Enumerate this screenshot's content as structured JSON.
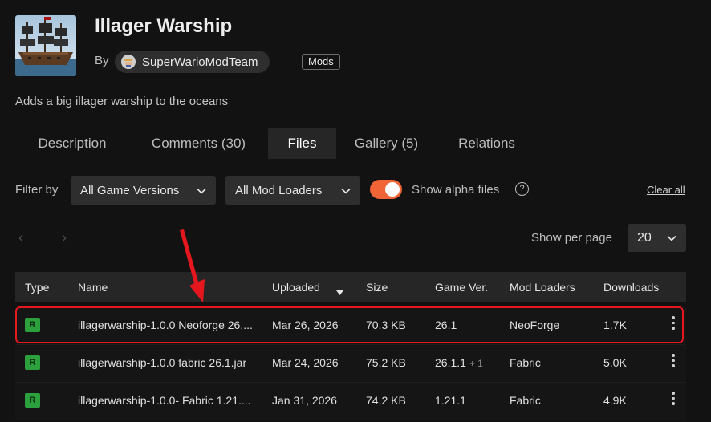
{
  "project": {
    "title": "Illager Warship",
    "by_label": "By",
    "author": "SuperWarioModTeam",
    "category_badge": "Mods",
    "summary": "Adds a big illager warship to the oceans"
  },
  "tabs": [
    {
      "label": "Description",
      "active": false
    },
    {
      "label": "Comments (30)",
      "active": false
    },
    {
      "label": "Files",
      "active": true
    },
    {
      "label": "Gallery (5)",
      "active": false
    },
    {
      "label": "Relations",
      "active": false
    }
  ],
  "filters": {
    "label": "Filter by",
    "game_versions": "All Game Versions",
    "mod_loaders": "All Mod Loaders",
    "show_alpha_label": "Show alpha files",
    "show_alpha_on": true,
    "help_glyph": "?",
    "clear_all": "Clear all"
  },
  "pagination": {
    "prev_glyph": "‹",
    "next_glyph": "›",
    "per_page_label": "Show per page",
    "per_page_value": "20"
  },
  "table": {
    "columns": {
      "type": "Type",
      "name": "Name",
      "uploaded": "Uploaded",
      "size": "Size",
      "game_ver": "Game Ver.",
      "mod_loaders": "Mod Loaders",
      "downloads": "Downloads"
    },
    "rows": [
      {
        "type": "R",
        "name": "illagerwarship-1.0.0 Neoforge 26....",
        "uploaded": "Mar 26, 2026",
        "size": "70.3 KB",
        "game_ver": "26.1",
        "game_ver_extra": "",
        "loader": "NeoForge",
        "downloads": "1.7K"
      },
      {
        "type": "R",
        "name": "illagerwarship-1.0.0 fabric 26.1.jar",
        "uploaded": "Mar 24, 2026",
        "size": "75.2 KB",
        "game_ver": "26.1.1",
        "game_ver_extra": "+ 1",
        "loader": "Fabric",
        "downloads": "5.0K"
      },
      {
        "type": "R",
        "name": "illagerwarship-1.0.0- Fabric 1.21....",
        "uploaded": "Jan 31, 2026",
        "size": "74.2 KB",
        "game_ver": "1.21.1",
        "game_ver_extra": "",
        "loader": "Fabric",
        "downloads": "4.9K"
      }
    ]
  },
  "colors": {
    "accent_orange": "#f16436",
    "release_green": "#2ca03c",
    "annotation_red": "#e4161e"
  }
}
